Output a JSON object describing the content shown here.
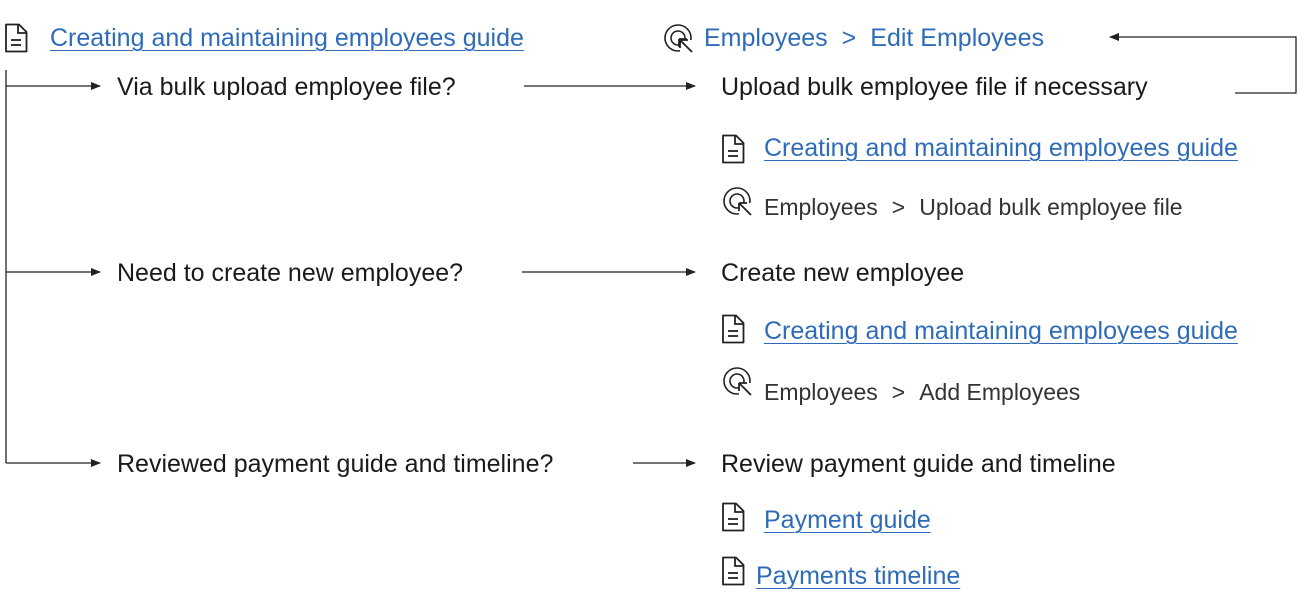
{
  "header": {
    "guide_link": "Creating and maintaining employees guide",
    "nav": {
      "first": "Employees",
      "separator": ">",
      "second": "Edit Employees"
    }
  },
  "branches": [
    {
      "question": "Via bulk upload employee file?",
      "action": "Upload bulk employee file if necessary",
      "guide_link": "Creating and maintaining employees guide",
      "nav": {
        "first": "Employees",
        "separator": ">",
        "second": "Upload bulk employee file"
      }
    },
    {
      "question": "Need to create new employee?",
      "action": "Create new employee",
      "guide_link": "Creating and maintaining employees guide",
      "nav": {
        "first": "Employees",
        "separator": ">",
        "second": "Add Employees"
      }
    },
    {
      "question": "Reviewed payment guide and timeline?",
      "action": "Review payment guide and timeline",
      "links": [
        "Payment guide",
        "Payments timeline"
      ]
    }
  ],
  "icons": {
    "document": "document-icon",
    "navigation": "cursor-click-icon"
  },
  "colors": {
    "link": "#2e6bb8",
    "text": "#1a1a1a",
    "line": "#222222"
  }
}
